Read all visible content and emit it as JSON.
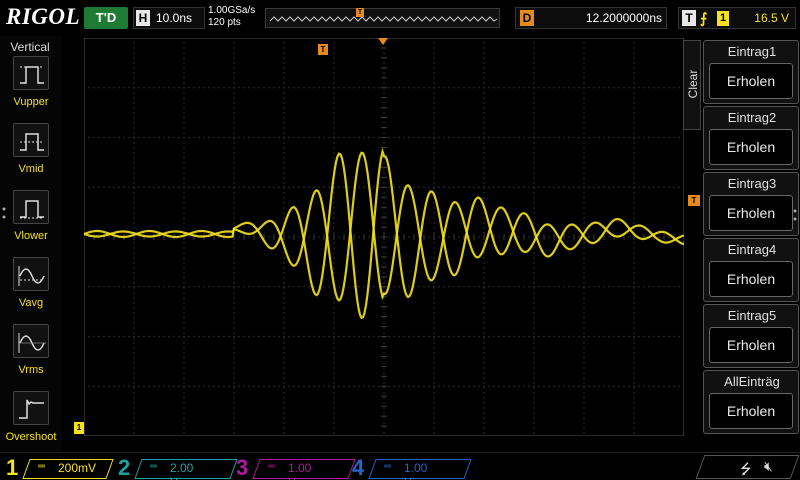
{
  "brand": "RIGOL",
  "status": {
    "run_state": "T'D"
  },
  "horizontal": {
    "label": "H",
    "timebase": "10.0ns",
    "sample_rate": "1.00GSa/s",
    "points": "120 pts"
  },
  "delay": {
    "label": "D",
    "value": "12.2000000ns"
  },
  "trigger": {
    "label": "T",
    "edge": "rising-edge-icon",
    "source": "1",
    "level": "16.5 V"
  },
  "left_menu": {
    "title": "Vertical",
    "items": [
      {
        "label": "Vupper",
        "icon": "vupper-icon"
      },
      {
        "label": "Vmid",
        "icon": "vmid-icon"
      },
      {
        "label": "Vlower",
        "icon": "vlower-icon"
      },
      {
        "label": "Vavg",
        "icon": "vavg-icon"
      },
      {
        "label": "Vrms",
        "icon": "vrms-icon"
      },
      {
        "label": "Overshoot",
        "icon": "overshoot-icon"
      }
    ]
  },
  "right_menu": {
    "clear_label": "Clear",
    "items": [
      {
        "title": "Eintrag1",
        "value": "Erholen"
      },
      {
        "title": "Eintrag2",
        "value": "Erholen"
      },
      {
        "title": "Eintrag3",
        "value": "Erholen"
      },
      {
        "title": "Eintrag4",
        "value": "Erholen"
      },
      {
        "title": "Eintrag5",
        "value": "Erholen"
      },
      {
        "title": "AllEinträg",
        "value": "Erholen"
      }
    ]
  },
  "channels": [
    {
      "num": "1",
      "scale": "200mV",
      "color": "#f5e21c",
      "active": true
    },
    {
      "num": "2",
      "scale": "2.00 V",
      "color": "#1aa3a3",
      "active": false
    },
    {
      "num": "3",
      "scale": "1.00 V",
      "color": "#b01aa0",
      "active": false
    },
    {
      "num": "4",
      "scale": "1.00 V",
      "color": "#2266cc",
      "active": false
    }
  ],
  "markers": {
    "trigger_pos": "T",
    "ground": "1"
  },
  "colors": {
    "trace": "#f5e21c",
    "marker": "#e58a1c",
    "grid": "#3c3c3c"
  }
}
